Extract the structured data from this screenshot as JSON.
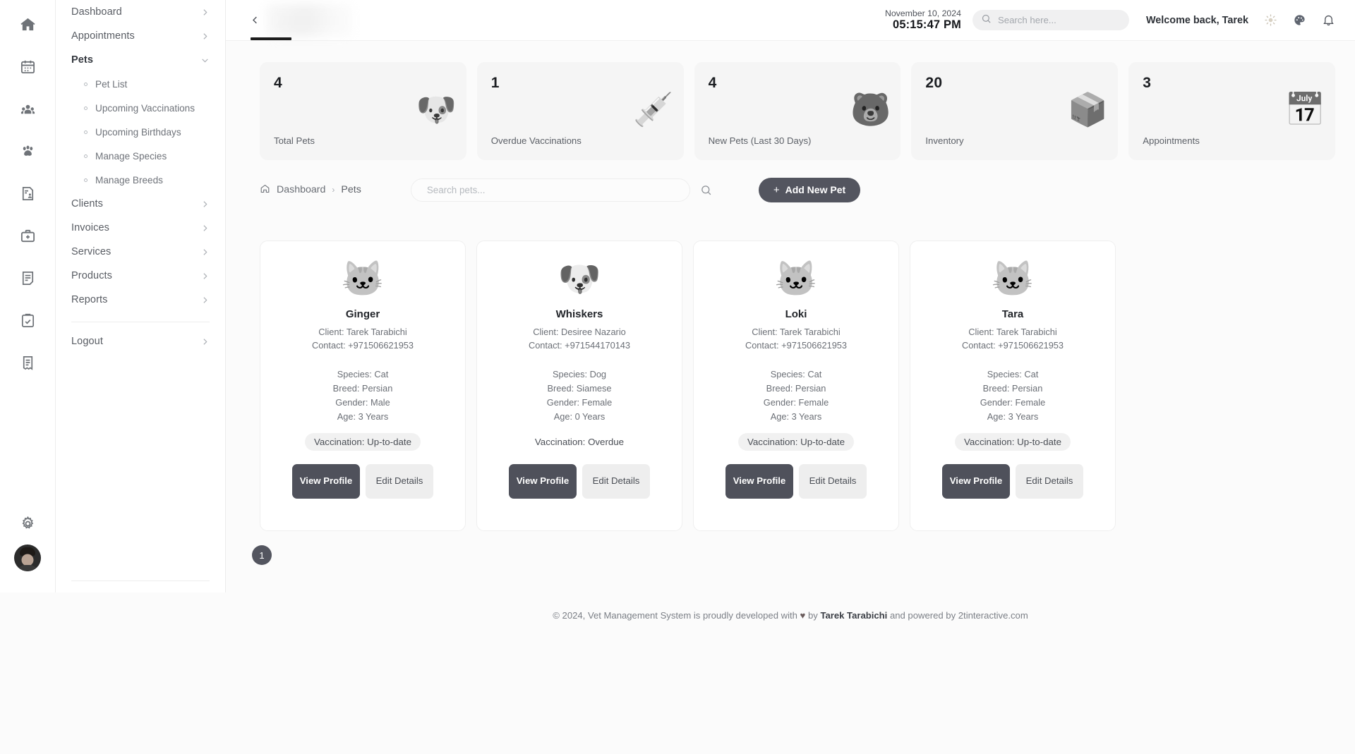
{
  "rail": {
    "icons": [
      {
        "name": "home-icon",
        "label": "Dashboard"
      },
      {
        "name": "calendar-icon",
        "label": "Appointments"
      },
      {
        "name": "clients-icon",
        "label": "Clients"
      },
      {
        "name": "paw-icon",
        "label": "Pets"
      },
      {
        "name": "invoice-icon",
        "label": "Invoices"
      },
      {
        "name": "medical-kit-icon",
        "label": "Services"
      },
      {
        "name": "document-icon",
        "label": "Products"
      },
      {
        "name": "clipboard-check-icon",
        "label": "Reports"
      },
      {
        "name": "receipt-icon",
        "label": "Receipts"
      }
    ],
    "settings_icon": "gear-icon",
    "avatar": "user-avatar"
  },
  "sidebar": {
    "items": [
      {
        "label": "Dashboard",
        "expandable": true,
        "expanded": false
      },
      {
        "label": "Appointments",
        "expandable": true,
        "expanded": false
      },
      {
        "label": "Pets",
        "expandable": true,
        "expanded": true
      },
      {
        "label": "Clients",
        "expandable": true,
        "expanded": false
      },
      {
        "label": "Invoices",
        "expandable": true,
        "expanded": false
      },
      {
        "label": "Services",
        "expandable": true,
        "expanded": false
      },
      {
        "label": "Products",
        "expandable": true,
        "expanded": false
      },
      {
        "label": "Reports",
        "expandable": true,
        "expanded": false
      }
    ],
    "pets_submenu": [
      {
        "label": "Pet List"
      },
      {
        "label": "Upcoming Vaccinations"
      },
      {
        "label": "Upcoming Birthdays"
      },
      {
        "label": "Manage Species"
      },
      {
        "label": "Manage Breeds"
      }
    ],
    "logout": {
      "label": "Logout"
    }
  },
  "topbar": {
    "date": "November 10, 2024",
    "time": "05:15:47 PM",
    "search_placeholder": "Search here...",
    "search_value": "",
    "welcome": "Welcome back, Tarek",
    "icons": [
      "sun-icon",
      "palette-icon",
      "bell-icon"
    ]
  },
  "stats": [
    {
      "value": "4",
      "label": "Total Pets",
      "emoji": "🐶"
    },
    {
      "value": "1",
      "label": "Overdue Vaccinations",
      "emoji": "💉"
    },
    {
      "value": "4",
      "label": "New Pets (Last 30 Days)",
      "emoji": "🐻"
    },
    {
      "value": "20",
      "label": "Inventory",
      "emoji": "📦"
    },
    {
      "value": "3",
      "label": "Appointments",
      "emoji": "📅"
    }
  ],
  "toolbar": {
    "breadcrumb": {
      "home": "Dashboard",
      "separator": "›",
      "current": "Pets"
    },
    "search_placeholder": "Search pets...",
    "search_value": "",
    "add_button": "Add New Pet",
    "add_button_plus": "+"
  },
  "pets": [
    {
      "name": "Ginger",
      "emoji": "🐱",
      "client": "Client: Tarek Tarabichi",
      "contact": "Contact: +971506621953",
      "species": "Species: Cat",
      "breed": "Breed: Persian",
      "gender": "Gender: Male",
      "age": "Age: 3 Years",
      "vaccination": "Vaccination: Up-to-date",
      "vaccination_status": "ok",
      "view_button": "View Profile",
      "edit_button": "Edit Details"
    },
    {
      "name": "Whiskers",
      "emoji": "🐶",
      "client": "Client: Desiree Nazario",
      "contact": "Contact: +971544170143",
      "species": "Species: Dog",
      "breed": "Breed: Siamese",
      "gender": "Gender: Female",
      "age": "Age: 0 Years",
      "vaccination": "Vaccination: Overdue",
      "vaccination_status": "overdue",
      "view_button": "View Profile",
      "edit_button": "Edit Details"
    },
    {
      "name": "Loki",
      "emoji": "🐱",
      "client": "Client: Tarek Tarabichi",
      "contact": "Contact: +971506621953",
      "species": "Species: Cat",
      "breed": "Breed: Persian",
      "gender": "Gender: Female",
      "age": "Age: 3 Years",
      "vaccination": "Vaccination: Up-to-date",
      "vaccination_status": "ok",
      "view_button": "View Profile",
      "edit_button": "Edit Details"
    },
    {
      "name": "Tara",
      "emoji": "🐱",
      "client": "Client: Tarek Tarabichi",
      "contact": "Contact: +971506621953",
      "species": "Species: Cat",
      "breed": "Breed: Persian",
      "gender": "Gender: Female",
      "age": "Age: 3 Years",
      "vaccination": "Vaccination: Up-to-date",
      "vaccination_status": "ok",
      "view_button": "View Profile",
      "edit_button": "Edit Details"
    }
  ],
  "pagination": {
    "pages": [
      "1"
    ],
    "current": "1"
  },
  "footer": {
    "prefix": "© 2024, Vet Management System is proudly developed with",
    "heart": "♥",
    "by": "by",
    "author": "Tarek Tarabichi",
    "suffix": "and powered by 2tinteractive.com"
  },
  "colors": {
    "accent": "#53555f",
    "primary_button": "#4f515b",
    "page_background": "#fbfbfb",
    "card_background": "#ffffff",
    "stat_background": "#f5f5f5"
  }
}
